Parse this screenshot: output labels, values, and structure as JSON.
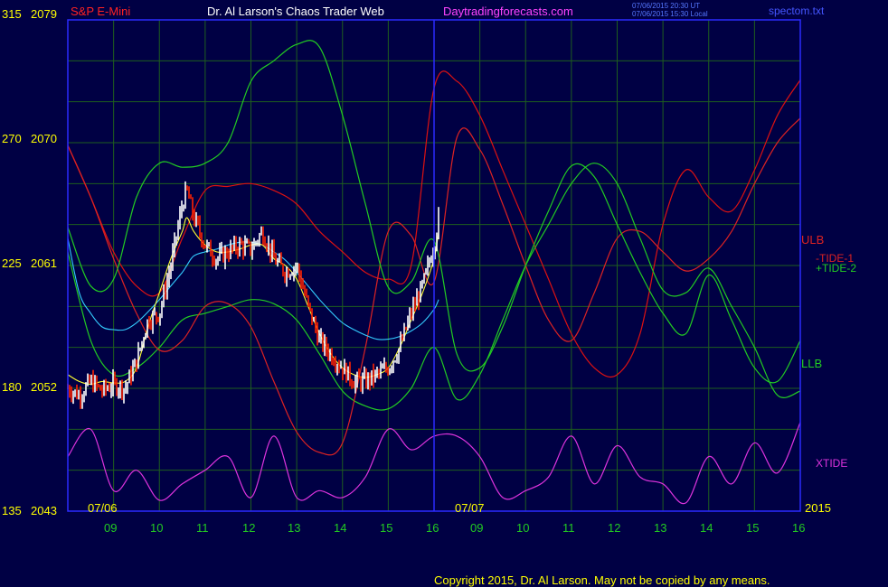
{
  "header": {
    "instrument": "S&P E-Mini",
    "title": "Dr. Al Larson's Chaos Trader Web",
    "site": "Daytradingforecasts.com",
    "timestamp_ut": "07/06/2015 20:30 UT",
    "timestamp_local": "07/06/2015 15:30 Local",
    "file": "spectom.txt"
  },
  "footer": {
    "copyright": "Copyright 2015, Dr. Al Larson. May not be copied by any means."
  },
  "colors": {
    "background": "#000044",
    "grid": "#1e5e1e",
    "border": "#2a2aff",
    "price_up": "#ffffff",
    "price_down": "#ff2200",
    "ulb": "#dd1111",
    "llb": "#22cc22",
    "tide1": "#dd2222",
    "tide2": "#22cc22",
    "xtide": "#dd33dd",
    "yellow_avg": "#ffff33",
    "cyan_avg": "#33ccff"
  },
  "chart_data": {
    "type": "line",
    "title": "S&P E-Mini",
    "left_axis_1": {
      "ticks": [
        "315",
        "270",
        "225",
        "180",
        "135"
      ]
    },
    "left_axis_2": {
      "ticks": [
        "2079",
        "2070",
        "2061",
        "2052",
        "2043"
      ],
      "ylim": [
        2043,
        2079
      ]
    },
    "x_ticks_day1": [
      "09",
      "10",
      "11",
      "12",
      "13",
      "14",
      "15",
      "16"
    ],
    "x_ticks_day2": [
      "09",
      "10",
      "11",
      "12",
      "13",
      "14",
      "15",
      "16"
    ],
    "date_labels": [
      "07/06",
      "07/07"
    ],
    "year_label": "2015",
    "series_labels": {
      "ulb": "ULB",
      "tide1": "-TIDE-1",
      "tide2": "+TIDE-2",
      "llb": "LLB",
      "xtide": "XTIDE"
    },
    "hours_x": [
      8,
      8.5,
      9,
      9.5,
      10,
      10.5,
      11,
      11.5,
      12,
      12.5,
      13,
      13.5,
      14,
      14.5,
      15,
      15.5,
      16,
      16.5,
      17,
      17.5,
      18,
      18.5,
      19,
      19.5,
      20,
      20.5,
      21,
      21.5,
      22,
      22.5,
      23,
      23.5,
      24
    ],
    "series": [
      {
        "key": "ulb",
        "values": [
          2069.8,
          2066,
          2062,
          2059.5,
          2059,
          2063,
          2066.5,
          2066.8,
          2067,
          2066.5,
          2065.5,
          2063.5,
          2062,
          2060.5,
          2060,
          2061,
          2074,
          2074.5,
          2072,
          2068,
          2064,
          2060,
          2056,
          2053.5,
          2053,
          2056,
          2064,
          2068,
          2066,
          2065,
          2068,
          2072,
          2074.6
        ]
      },
      {
        "key": "llb",
        "values": [
          2062,
          2055.5,
          2053,
          2053.5,
          2055,
          2057,
          2057.5,
          2058,
          2058.5,
          2058.2,
          2057,
          2054.5,
          2051.8,
          2050.7,
          2050.5,
          2052,
          2055,
          2051.2,
          2053,
          2057,
          2061,
          2064,
          2067,
          2068.5,
          2067,
          2063,
          2059.2,
          2059,
          2060.8,
          2058,
          2055,
          2051.5,
          2051.8
        ]
      },
      {
        "key": "tide1",
        "values": [
          2069.8,
          2066,
          2061.5,
          2057.5,
          2054.8,
          2055.5,
          2058,
          2058.2,
          2056.5,
          2052.5,
          2048.8,
          2047.3,
          2048,
          2055,
          2063.5,
          2063.2,
          2059.8,
          2070.4,
          2069.5,
          2065.5,
          2061,
          2057,
          2055.5,
          2059,
          2063,
          2063.5,
          2062,
          2060.6,
          2061.5,
          2063.5,
          2067,
          2070,
          2071.8
        ]
      },
      {
        "key": "tide2",
        "values": [
          2063.8,
          2059.5,
          2060,
          2066,
          2068.5,
          2068.2,
          2068.5,
          2070,
          2074.5,
          2076,
          2077.2,
          2077,
          2072,
          2065.5,
          2059.4,
          2059.8,
          2062.8,
          2054.5,
          2053.5,
          2056.5,
          2061,
          2065,
          2068.3,
          2067.5,
          2064,
          2060.5,
          2057.5,
          2056,
          2060.3,
          2057,
          2053.5,
          2052.5,
          2055.5
        ]
      },
      {
        "key": "xtide",
        "values": [
          2047,
          2049,
          2044.5,
          2046,
          2043.8,
          2045,
          2046,
          2047,
          2044,
          2048.5,
          2044,
          2044.5,
          2044,
          2045.5,
          2049,
          2047.5,
          2048.5,
          2048.5,
          2047,
          2044,
          2044.5,
          2045.5,
          2048.5,
          2045,
          2047.8,
          2045.5,
          2045,
          2043.6,
          2047,
          2045,
          2048,
          2045.8,
          2049.5
        ]
      }
    ],
    "price_x": [
      8,
      8.25,
      8.5,
      8.75,
      9,
      9.25,
      9.5,
      9.75,
      10,
      10.25,
      10.5,
      10.6,
      10.75,
      11,
      11.25,
      11.5,
      11.75,
      12,
      12.25,
      12.5,
      12.75,
      13,
      13.25,
      13.5,
      13.75,
      14,
      14.25,
      14.5,
      14.75,
      15,
      15.25,
      15.5,
      15.75,
      16,
      16.1
    ],
    "price": [
      2052,
      2051.5,
      2052.5,
      2051.8,
      2052.3,
      2052,
      2054,
      2057,
      2057.5,
      2061,
      2065.5,
      2066.5,
      2064.5,
      2062.5,
      2061.5,
      2062,
      2062.5,
      2062.2,
      2063.5,
      2061.5,
      2060.5,
      2061,
      2058,
      2055.5,
      2054.5,
      2053.5,
      2052.5,
      2052.5,
      2053,
      2053.5,
      2055,
      2057.5,
      2059.5,
      2062.5,
      2064.5
    ],
    "yellow_avg": [
      2053,
      2052.5,
      2052.3,
      2052.5,
      2052.4,
      2052.5,
      2053.5,
      2056.5,
      2059,
      2061.5,
      2063.5,
      2064.5,
      2063.5,
      2062.5,
      2062,
      2062,
      2062.2,
      2062.5,
      2062.5,
      2061.5,
      2061,
      2060,
      2058,
      2056,
      2054.5,
      2053.5,
      2053,
      2052.8,
      2053,
      2053.5,
      2055,
      2057,
      2059,
      2061.5,
      2063.5
    ],
    "cyan_avg": [
      2063,
      2059,
      2057.5,
      2056.5,
      2056.3,
      2056.3,
      2056.8,
      2057.6,
      2058.5,
      2059.5,
      2060.5,
      2061,
      2061.7,
      2062,
      2062.2,
      2062.5,
      2062.7,
      2062.7,
      2062.5,
      2062,
      2061.4,
      2060.5,
      2059.5,
      2058.5,
      2057.6,
      2056.8,
      2056.3,
      2055.9,
      2055.6,
      2055.6,
      2055.8,
      2056.2,
      2056.8,
      2057.8,
      2058.5
    ]
  }
}
